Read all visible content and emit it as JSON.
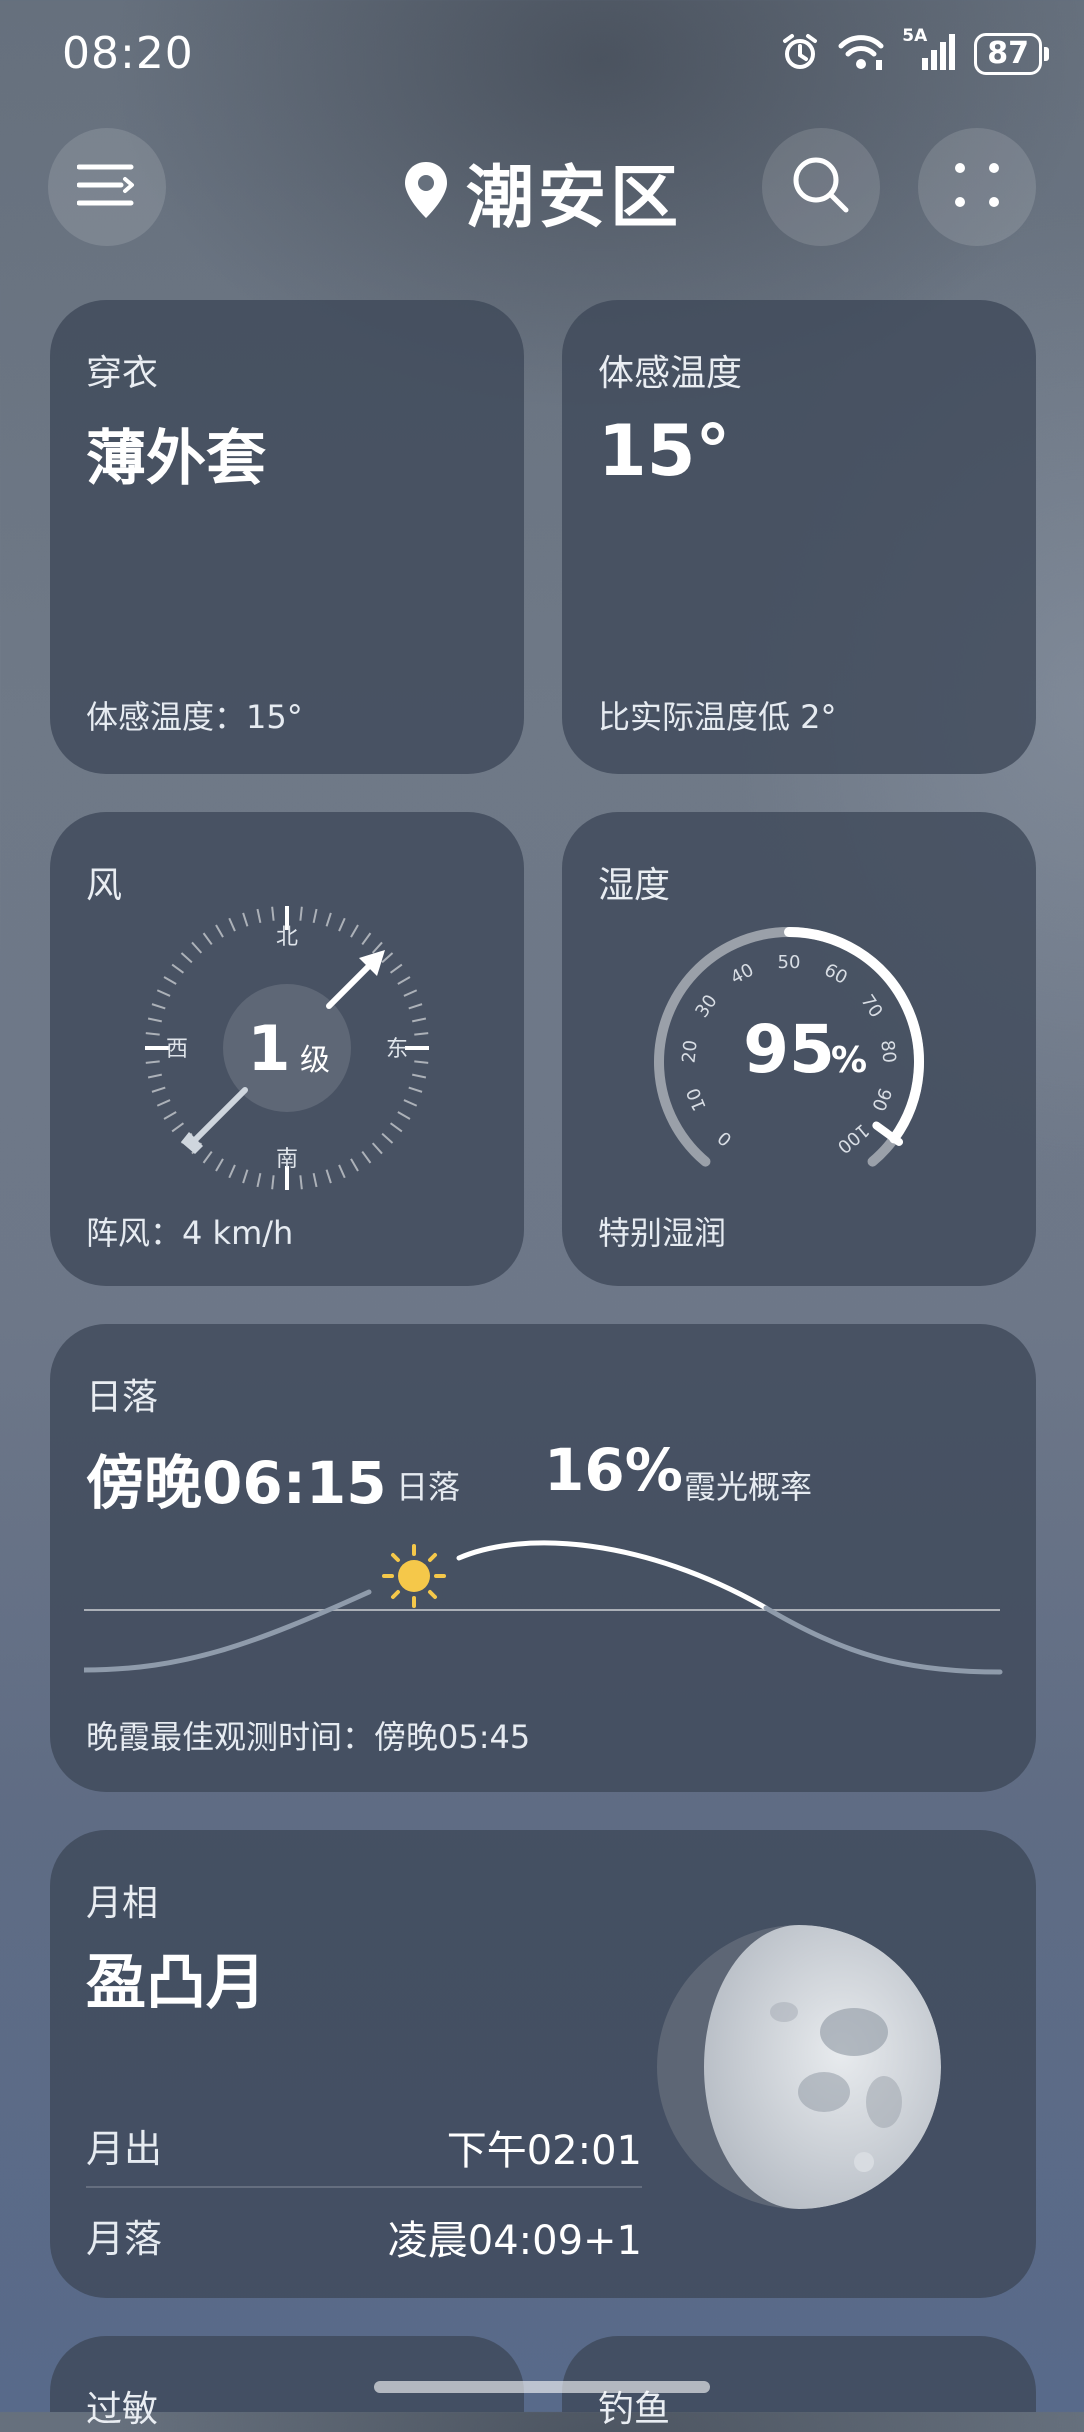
{
  "status_bar": {
    "time": "08:20",
    "network": "5A",
    "battery": "87"
  },
  "header": {
    "location": "潮安区"
  },
  "clothing": {
    "title": "穿衣",
    "value": "薄外套",
    "detail": "体感温度：15°"
  },
  "feels_like": {
    "title": "体感温度",
    "value": "15°",
    "detail": "比实际温度低 2°"
  },
  "wind": {
    "title": "风",
    "level_num": "1",
    "level_unit": "级",
    "north": "北",
    "south": "南",
    "east": "东",
    "west": "西",
    "gust": "阵风：4 km/h"
  },
  "humidity": {
    "title": "湿度",
    "value": "95",
    "unit": "%",
    "description": "特别湿润",
    "ticks": [
      "0",
      "10",
      "20",
      "30",
      "40",
      "50",
      "60",
      "70",
      "80",
      "90",
      "100"
    ],
    "level": 95
  },
  "sunset": {
    "title": "日落",
    "time": "傍晚06:15",
    "time_label": "日落",
    "probability": "16%",
    "probability_label": "霞光概率",
    "best_time": "晚霞最佳观测时间：傍晚05:45"
  },
  "moon": {
    "title": "月相",
    "phase": "盈凸月",
    "rise_label": "月出",
    "rise_value": "下午02:01",
    "set_label": "月落",
    "set_value": "凌晨04:09+1"
  },
  "bottom_cards": {
    "allergy": "过敏",
    "fishing": "钓鱼"
  },
  "colors": {
    "sun": "#f5c84a",
    "card": "#3e4858"
  }
}
